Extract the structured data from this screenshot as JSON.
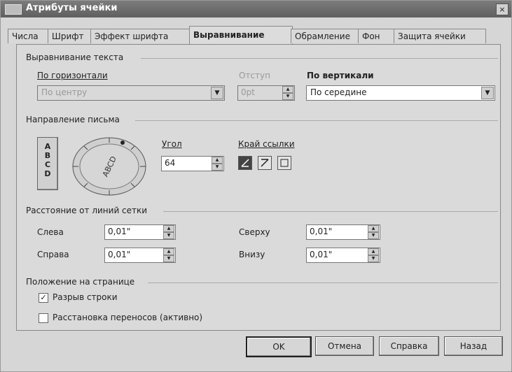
{
  "window": {
    "title": "Атрибуты ячейки",
    "close": "×"
  },
  "tabs": [
    {
      "label": "Числа"
    },
    {
      "label": "Шрифт"
    },
    {
      "label": "Эффект шрифта"
    },
    {
      "label": "Выравнивание"
    },
    {
      "label": "Обрамление"
    },
    {
      "label": "Фон"
    },
    {
      "label": "Защита ячейки"
    }
  ],
  "text_alignment": {
    "section": "Выравнивание текста",
    "horizontal_label": "По горизонтали",
    "horizontal_value": "По центру",
    "indent_label": "Отступ",
    "indent_value": "0pt",
    "vertical_label": "По вертикали",
    "vertical_value": "По середине"
  },
  "direction": {
    "section": "Направление письма",
    "vertical_letters": [
      "A",
      "B",
      "C",
      "D"
    ],
    "dial_text": "ABCD",
    "angle_label": "Угол",
    "angle_value": "64",
    "ref_edge_label": "Край ссылки"
  },
  "spacing": {
    "section": "Расстояние от линий сетки",
    "left_label": "Слева",
    "left_value": "0,01\"",
    "right_label": "Справа",
    "right_value": "0,01\"",
    "top_label": "Сверху",
    "top_value": "0,01\"",
    "bottom_label": "Внизу",
    "bottom_value": "0,01\""
  },
  "page_position": {
    "section": "Положение на странице",
    "wrap_label": "Разрыв строки",
    "wrap_checked": true,
    "hyphen_label": "Расстановка переносов (активно)",
    "hyphen_checked": false
  },
  "buttons": {
    "ok": "OK",
    "cancel": "Отмена",
    "help": "Справка",
    "back": "Назад"
  }
}
